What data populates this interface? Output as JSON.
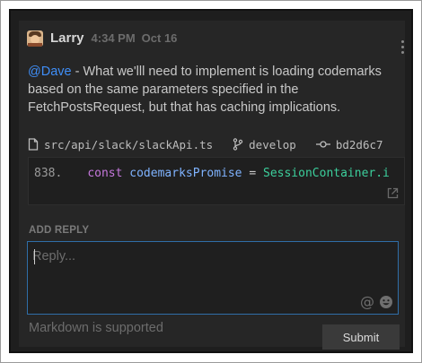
{
  "post": {
    "author": "Larry",
    "time": "4:34 PM",
    "date": "Oct 16",
    "mention": "@Dave",
    "text_line1": " - What we'lll need to implement is loading codemarks",
    "text_line2": "based on the same parameters specified in the",
    "text_line3": "FetchPostsRequest, but that has caching implications."
  },
  "codemark": {
    "file_path": "src/api/slack/slackApi.ts",
    "branch": "develop",
    "commit": "bd2d6c7",
    "line_number": "838.",
    "code_keyword": "const",
    "code_identifier": "codemarksPromise",
    "code_operator": "=",
    "code_class": "SessionContainer.i"
  },
  "reply": {
    "section_label": "ADD REPLY",
    "placeholder": "Reply...",
    "value": "",
    "markdown_note": "Markdown is supported",
    "submit_label": "Submit"
  },
  "icons": {
    "file": "file-icon",
    "branch": "git-branch-icon",
    "commit": "git-commit-icon",
    "open": "open-external-icon",
    "mention": "at-icon",
    "emoji": "emoji-icon",
    "menu": "kebab-menu-icon"
  },
  "colors": {
    "mention": "#3f8ef7",
    "keyword": "#c678dd",
    "identifier": "#7fb3ff",
    "class": "#3ccf9c",
    "focus_border": "#2f6ea8"
  }
}
